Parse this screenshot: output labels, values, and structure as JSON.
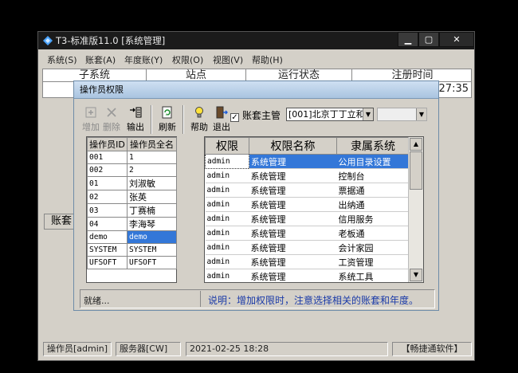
{
  "app": {
    "title": "T3-标准版11.0 [系统管理]",
    "min_label": "▁",
    "max_label": "▢",
    "close_label": "✕"
  },
  "menu": [
    "系统(S)",
    "账套(A)",
    "年度账(Y)",
    "权限(O)",
    "视图(V)",
    "帮助(H)"
  ],
  "background": {
    "columns": [
      "子系统",
      "站点",
      "运行状态",
      "注册时间"
    ],
    "time_value": "27:35",
    "account_label": "账套"
  },
  "statusbar": {
    "operator": "操作员[admin]",
    "server": "服务器[CW]",
    "datetime": "2021-02-25 18:28",
    "brand": "【畅捷通软件】"
  },
  "dialog": {
    "title": "操作员权限",
    "toolbar": {
      "add": "增加",
      "delete": "删除",
      "export": "输出",
      "refresh": "刷新",
      "help": "帮助",
      "exit": "退出"
    },
    "account_master_label": "账套主管",
    "account_master_checked": true,
    "account_combo": "[001]北京丁丁立和",
    "year_combo": "",
    "user_grid": {
      "headers": [
        "操作员ID",
        "操作员全名"
      ],
      "rows": [
        [
          "001",
          "1"
        ],
        [
          "002",
          "2"
        ],
        [
          "01",
          "刘淑敏"
        ],
        [
          "02",
          "张英"
        ],
        [
          "03",
          "丁赛楠"
        ],
        [
          "04",
          "李海琴"
        ],
        [
          "demo",
          "demo"
        ],
        [
          "SYSTEM",
          "SYSTEM"
        ],
        [
          "UFSOFT",
          "UFSOFT"
        ]
      ],
      "selected_index": 6
    },
    "perm_grid": {
      "headers": [
        "权限",
        "权限名称",
        "隶属系统"
      ],
      "rows": [
        [
          "admin",
          "系统管理",
          "公用目录设置"
        ],
        [
          "admin",
          "系统管理",
          "控制台"
        ],
        [
          "admin",
          "系统管理",
          "票据通"
        ],
        [
          "admin",
          "系统管理",
          "出纳通"
        ],
        [
          "admin",
          "系统管理",
          "信用服务"
        ],
        [
          "admin",
          "系统管理",
          "老板通"
        ],
        [
          "admin",
          "系统管理",
          "会计家园"
        ],
        [
          "admin",
          "系统管理",
          "工资管理"
        ],
        [
          "admin",
          "系统管理",
          "系统工具"
        ]
      ],
      "selected_index": 0
    },
    "status_ready": "就绪...",
    "hint": "说明：增加权限时，注意选择相关的账套和年度。"
  },
  "colors": {
    "selection": "#3377d8",
    "hint_text": "#1a3aa8",
    "dialog_title_bg": "#b9d1ea"
  }
}
